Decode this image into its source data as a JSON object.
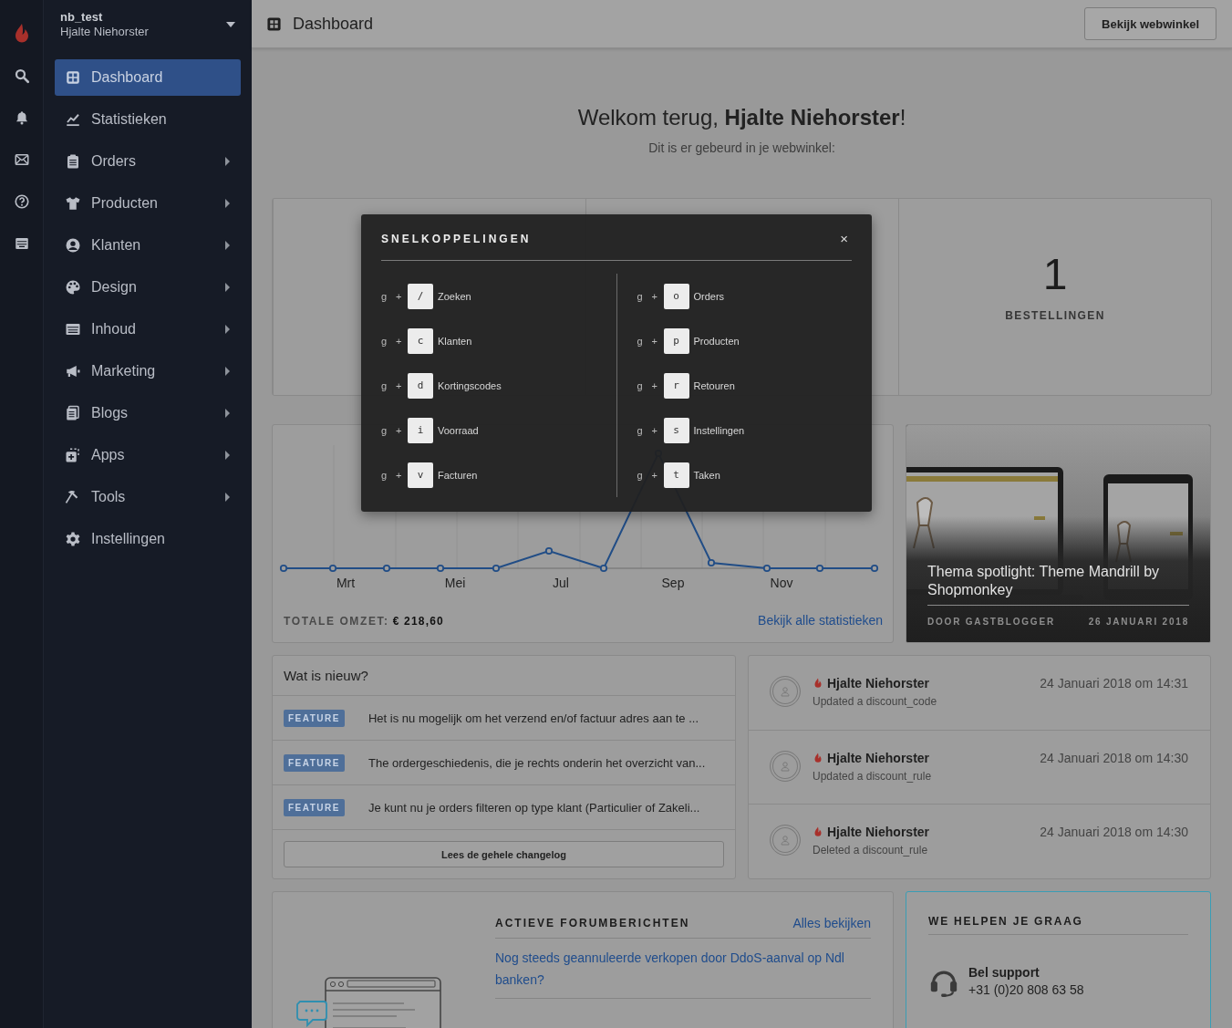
{
  "account": {
    "shop": "nb_test",
    "user": "Hjalte Niehorster"
  },
  "sidebar": {
    "items": [
      {
        "label": "Dashboard",
        "selected": true,
        "has_submenu": false
      },
      {
        "label": "Statistieken",
        "selected": false,
        "has_submenu": false
      },
      {
        "label": "Orders",
        "selected": false,
        "has_submenu": true
      },
      {
        "label": "Producten",
        "selected": false,
        "has_submenu": true
      },
      {
        "label": "Klanten",
        "selected": false,
        "has_submenu": true
      },
      {
        "label": "Design",
        "selected": false,
        "has_submenu": true
      },
      {
        "label": "Inhoud",
        "selected": false,
        "has_submenu": true
      },
      {
        "label": "Marketing",
        "selected": false,
        "has_submenu": true
      },
      {
        "label": "Blogs",
        "selected": false,
        "has_submenu": true
      },
      {
        "label": "Apps",
        "selected": false,
        "has_submenu": true
      },
      {
        "label": "Tools",
        "selected": false,
        "has_submenu": true
      },
      {
        "label": "Instellingen",
        "selected": false,
        "has_submenu": false
      }
    ]
  },
  "topbar": {
    "title": "Dashboard",
    "button": "Bekijk webwinkel"
  },
  "welcome": {
    "heading": "Welkom terug, **Hjalte Niehorster**!",
    "subtitle": "Dit is er gebeurd in je webwinkel:"
  },
  "stats": [
    {
      "value": "1",
      "label": "BESTELLINGEN"
    }
  ],
  "revenue_chart": {
    "x_labels": [
      "Mrt",
      "Mei",
      "Jul",
      "Sep",
      "Nov"
    ],
    "total_label": "TOTALE OMZET:",
    "total_value": "€ 218,60",
    "link": "Bekijk alle statistieken"
  },
  "spotlight": {
    "kind": "picture",
    "title": "Thema spotlight: Theme Mandrill by Shopmonkey",
    "author": "DOOR GASTBLOGGER",
    "date": "26 JANUARI 2018"
  },
  "news": {
    "title": "Wat is nieuw?",
    "items": [
      {
        "tag": "FEATURE",
        "text": "Het is nu mogelijk om het verzend en/of factuur adres aan te ..."
      },
      {
        "tag": "FEATURE",
        "text": "The ordergeschiedenis, die je rechts onderin het overzicht van..."
      },
      {
        "tag": "FEATURE",
        "text": "Je kunt nu je orders filteren op type klant (Particulier of Zakeli..."
      }
    ],
    "button": "Lees de gehele changelog"
  },
  "activity": [
    {
      "name": "Hjalte Niehorster",
      "action": "Updated a discount_code",
      "time": "24 Januari 2018 om 14:31"
    },
    {
      "name": "Hjalte Niehorster",
      "action": "Updated a discount_rule",
      "time": "24 Januari 2018 om 14:30"
    },
    {
      "name": "Hjalte Niehorster",
      "action": "Deleted a discount_rule",
      "time": "24 Januari 2018 om 14:30"
    }
  ],
  "forum": {
    "title": "ACTIEVE FORUMBERICHTEN",
    "link": "Alles bekijken",
    "posts": [
      "Nog steeds geannuleerde verkopen door DdoS-aanval op Ndl banken?"
    ]
  },
  "help": {
    "title": "WE HELPEN JE GRAAG",
    "support_title": "Bel support",
    "phone": "+31 (0)20 808 63 58"
  },
  "shortcuts_modal": {
    "title": "SNELKOPPELINGEN",
    "close": "×",
    "columns": [
      [
        {
          "prefix": "g",
          "plus": "+",
          "key": "/",
          "label": "Zoeken"
        },
        {
          "prefix": "g",
          "plus": "+",
          "key": "c",
          "label": "Klanten"
        },
        {
          "prefix": "g",
          "plus": "+",
          "key": "d",
          "label": "Kortingscodes"
        },
        {
          "prefix": "g",
          "plus": "+",
          "key": "i",
          "label": "Voorraad"
        },
        {
          "prefix": "g",
          "plus": "+",
          "key": "v",
          "label": "Facturen"
        }
      ],
      [
        {
          "prefix": "g",
          "plus": "+",
          "key": "o",
          "label": "Orders"
        },
        {
          "prefix": "g",
          "plus": "+",
          "key": "p",
          "label": "Producten"
        },
        {
          "prefix": "g",
          "plus": "+",
          "key": "r",
          "label": "Retouren"
        },
        {
          "prefix": "g",
          "plus": "+",
          "key": "s",
          "label": "Instellingen"
        },
        {
          "prefix": "g",
          "plus": "+",
          "key": "t",
          "label": "Taken"
        }
      ]
    ]
  }
}
